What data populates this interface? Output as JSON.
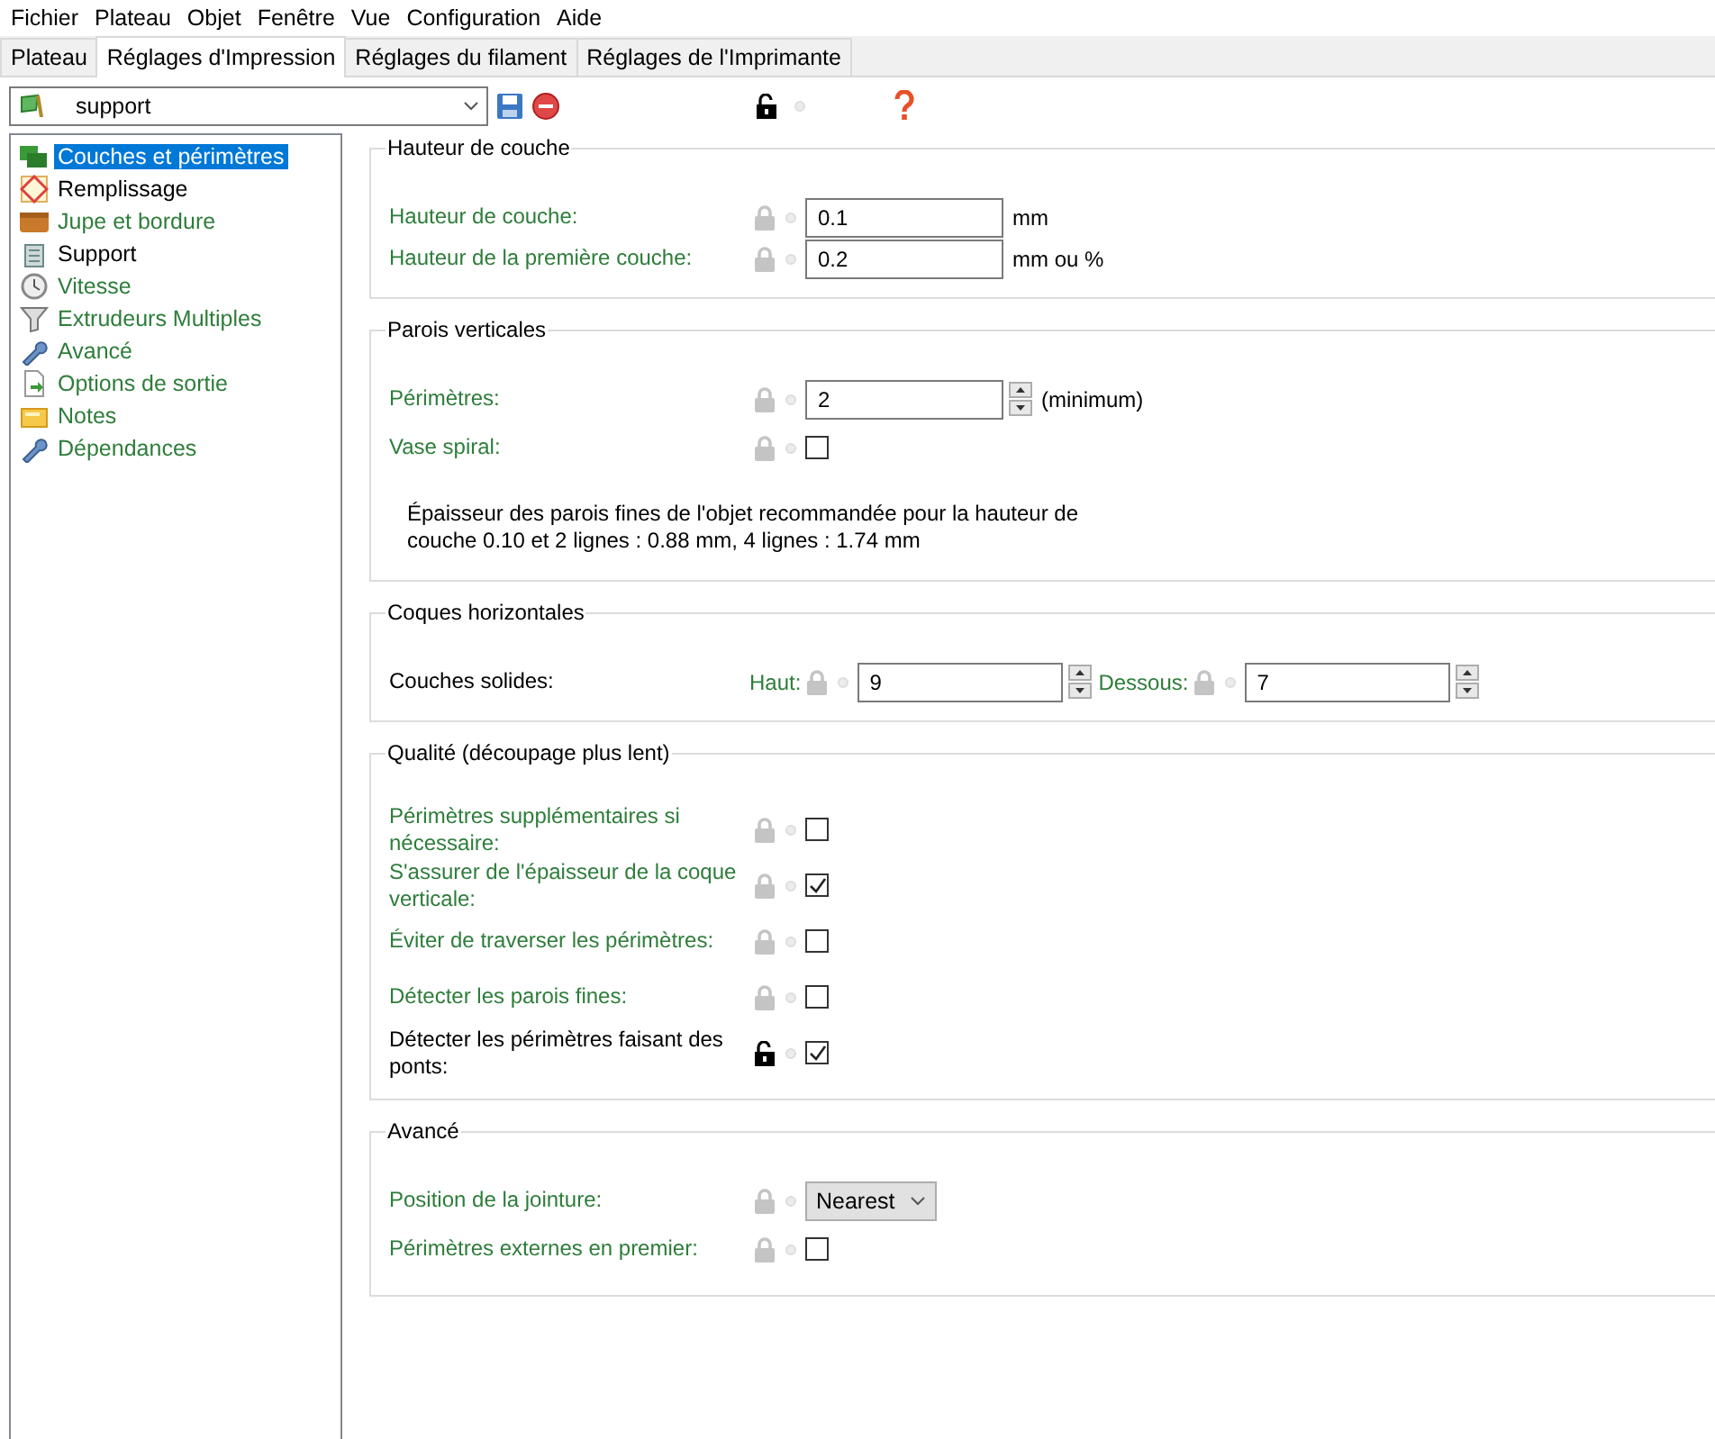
{
  "menu": [
    "Fichier",
    "Plateau",
    "Objet",
    "Fenêtre",
    "Vue",
    "Configuration",
    "Aide"
  ],
  "tabs": [
    {
      "label": "Plateau",
      "selected": false
    },
    {
      "label": "Réglages d'Impression",
      "selected": true
    },
    {
      "label": "Réglages du filament",
      "selected": false
    },
    {
      "label": "Réglages de l'Imprimante",
      "selected": false
    }
  ],
  "preset": {
    "value": "support",
    "unlocked": true
  },
  "sidebar": {
    "items": [
      {
        "label": "Couches et périmètres",
        "selected": true
      },
      {
        "label": "Remplissage",
        "selected": false,
        "modified": true
      },
      {
        "label": "Jupe et bordure",
        "selected": false,
        "modified": false
      },
      {
        "label": "Support",
        "selected": false,
        "modified": true
      },
      {
        "label": "Vitesse",
        "selected": false,
        "modified": false
      },
      {
        "label": "Extrudeurs Multiples",
        "selected": false,
        "modified": false
      },
      {
        "label": "Avancé",
        "selected": false,
        "modified": false
      },
      {
        "label": "Options de sortie",
        "selected": false,
        "modified": false
      },
      {
        "label": "Notes",
        "selected": false,
        "modified": false
      },
      {
        "label": "Dépendances",
        "selected": false,
        "modified": false
      }
    ]
  },
  "sections": [
    {
      "title": "Hauteur de couche",
      "rows": [
        {
          "kind": "text",
          "label": "Hauteur de couche:",
          "modified": false,
          "unlocked": false,
          "value": "0.1",
          "unit": "mm"
        },
        {
          "kind": "text",
          "label": "Hauteur de la première couche:",
          "modified": false,
          "unlocked": false,
          "value": "0.2",
          "unit": "mm ou %"
        }
      ]
    },
    {
      "title": "Parois verticales",
      "rows": [
        {
          "kind": "spin",
          "label": "Périmètres:",
          "modified": false,
          "unlocked": false,
          "value": "2",
          "unit": "(minimum)"
        },
        {
          "kind": "checkbox",
          "label": "Vase spiral:",
          "modified": false,
          "unlocked": false,
          "checked": false
        }
      ],
      "note": "Épaisseur des parois fines de l'objet recommandée pour la hauteur de couche 0.10 et 2 lignes : 0.88 mm, 4 lignes : 1.74 mm"
    },
    {
      "title": "Coques horizontales",
      "rows": [
        {
          "kind": "pair",
          "label": "Couches solides:",
          "modified": true,
          "fields": [
            {
              "label": "Haut:",
              "modified": false,
              "unlocked": false,
              "value": "9"
            },
            {
              "label": "Dessous:",
              "modified": false,
              "unlocked": false,
              "value": "7"
            }
          ]
        }
      ]
    },
    {
      "title": "Qualité (découpage plus lent)",
      "rows": [
        {
          "kind": "checkbox",
          "label": "Périmètres supplémentaires si nécessaire:",
          "modified": false,
          "unlocked": false,
          "checked": false
        },
        {
          "kind": "checkbox",
          "label": "S'assurer de l'épaisseur de la coque verticale:",
          "modified": false,
          "unlocked": false,
          "checked": true
        },
        {
          "kind": "checkbox",
          "label": "Éviter de traverser les périmètres:",
          "modified": false,
          "unlocked": false,
          "checked": false
        },
        {
          "kind": "checkbox",
          "label": "Détecter les parois fines:",
          "modified": false,
          "unlocked": false,
          "checked": false
        },
        {
          "kind": "checkbox",
          "label": "Détecter les périmètres faisant des ponts:",
          "modified": true,
          "unlocked": true,
          "checked": true
        }
      ]
    },
    {
      "title": "Avancé",
      "rows": [
        {
          "kind": "select",
          "label": "Position de la jointure:",
          "modified": false,
          "unlocked": false,
          "value": "Nearest"
        },
        {
          "kind": "checkbox",
          "label": "Périmètres externes en premier:",
          "modified": false,
          "unlocked": false,
          "checked": false
        }
      ]
    }
  ]
}
